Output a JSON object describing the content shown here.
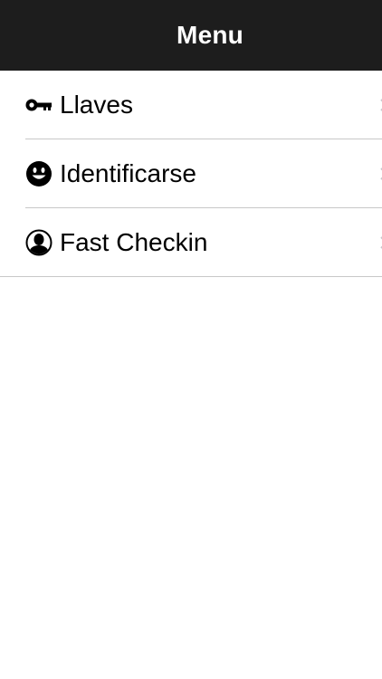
{
  "nav": {
    "title": "Menu"
  },
  "menu": {
    "items": [
      {
        "label": "Llaves",
        "icon": "key-icon"
      },
      {
        "label": "Identificarse",
        "icon": "smiley-icon"
      },
      {
        "label": "Fast Checkin",
        "icon": "user-icon"
      }
    ]
  },
  "colors": {
    "nav_background": "#1d1d1d",
    "nav_text": "#ffffff",
    "divider": "#c8c8c8",
    "text": "#000000",
    "background": "#ffffff"
  }
}
